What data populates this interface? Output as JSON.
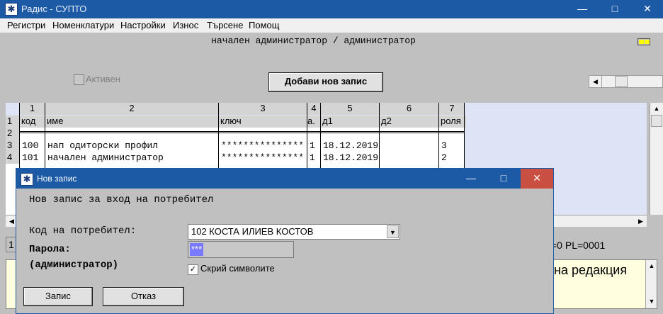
{
  "window": {
    "title": "Радис - СУПТО",
    "minimize": "—",
    "maximize": "□",
    "close": "✕"
  },
  "menu": [
    "Регистри",
    "Номенклатури",
    "Настройки",
    "Износ",
    "Търсене",
    "Помощ"
  ],
  "header_line": "начален администратор / администратор",
  "active_label": "Активен",
  "add_button": "Добави нов запис",
  "grid": {
    "col_numbers": [
      "1",
      "2",
      "3",
      "4",
      "5",
      "6",
      "7"
    ],
    "col_names": [
      "код",
      "име",
      "ключ",
      "а.",
      "д1",
      "д2",
      "роля"
    ],
    "row_numbers": [
      "1",
      "2",
      "3",
      "4"
    ],
    "rows": [
      [
        "100",
        "нап одиторски профил",
        "***************",
        "1",
        "18.12.2019",
        "",
        "3"
      ],
      [
        "101",
        "начален администратор",
        "***************",
        "1",
        "18.12.2019",
        "",
        "2"
      ]
    ]
  },
  "status": {
    "left": "1",
    "right": "=0 PL=0001",
    "message": "на редакция"
  },
  "dialog": {
    "title": "Нов запис",
    "heading": "Нов запис за вход на потребител",
    "user_code_label": "Код на потребител:",
    "user_code_value": "102 КОСТА ИЛИЕВ КОСТОВ",
    "password_label": "Парола:",
    "role_label": "(администратор)",
    "password_value": "***",
    "hide_symbols_label": "Скрий символите",
    "save_button": "Запис",
    "cancel_button": "Отказ",
    "minimize": "—",
    "maximize": "□",
    "close": "✕"
  }
}
